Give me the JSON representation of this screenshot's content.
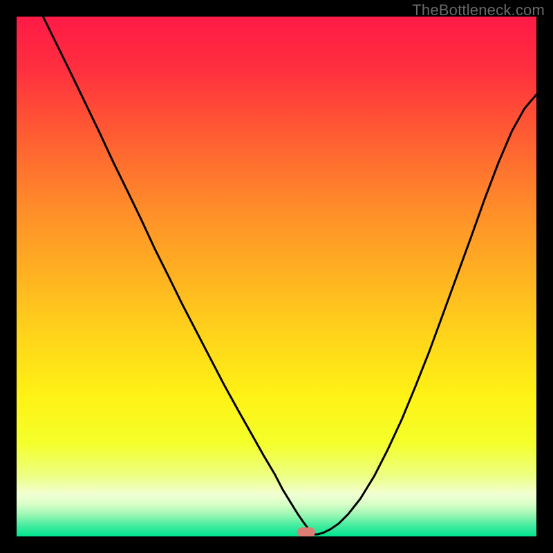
{
  "watermark": "TheBottleneck.com",
  "gradient_stops": [
    {
      "pos": 0.0,
      "color": "#ff1a46"
    },
    {
      "pos": 0.1,
      "color": "#ff2f3f"
    },
    {
      "pos": 0.22,
      "color": "#ff5a33"
    },
    {
      "pos": 0.36,
      "color": "#ff8a2a"
    },
    {
      "pos": 0.5,
      "color": "#ffb321"
    },
    {
      "pos": 0.62,
      "color": "#ffd61a"
    },
    {
      "pos": 0.73,
      "color": "#fff215"
    },
    {
      "pos": 0.82,
      "color": "#f4ff2a"
    },
    {
      "pos": 0.885,
      "color": "#ecff86"
    },
    {
      "pos": 0.918,
      "color": "#f2ffd2"
    },
    {
      "pos": 0.938,
      "color": "#d8ffc8"
    },
    {
      "pos": 0.958,
      "color": "#9cf7b4"
    },
    {
      "pos": 0.978,
      "color": "#48eda0"
    },
    {
      "pos": 1.0,
      "color": "#00e58f"
    }
  ],
  "chart_data": {
    "type": "line",
    "title": "",
    "xlabel": "",
    "ylabel": "",
    "xlim": [
      0,
      100
    ],
    "ylim": [
      0,
      100
    ],
    "grid": false,
    "series": [
      {
        "name": "bottleneck-curve",
        "x": [
          5.1,
          7.9,
          10.6,
          13.3,
          16.0,
          18.6,
          21.3,
          24.0,
          26.6,
          29.3,
          31.9,
          34.6,
          37.3,
          39.9,
          42.6,
          45.2,
          47.5,
          49.7,
          51.2,
          52.8,
          54.1,
          55.2,
          56.1,
          56.6,
          56.9,
          57.9,
          59.0,
          60.4,
          62.0,
          63.8,
          66.1,
          68.8,
          71.4,
          74.1,
          76.7,
          79.4,
          82.0,
          84.7,
          87.4,
          90.0,
          92.7,
          95.3,
          97.7,
          100.0
        ],
        "y": [
          100.0,
          94.3,
          88.8,
          83.2,
          77.6,
          72.0,
          66.5,
          60.9,
          55.3,
          49.9,
          44.6,
          39.4,
          34.2,
          29.2,
          24.3,
          19.7,
          15.6,
          11.9,
          9.0,
          6.4,
          4.3,
          2.7,
          1.5,
          0.7,
          0.4,
          0.4,
          0.7,
          1.4,
          2.5,
          4.3,
          7.2,
          11.6,
          16.7,
          22.5,
          28.8,
          35.6,
          42.7,
          50.1,
          57.5,
          64.8,
          71.9,
          78.0,
          82.3,
          85.0
        ]
      }
    ],
    "marker": {
      "x": 55.7,
      "y": 0.8
    },
    "annotations": []
  }
}
